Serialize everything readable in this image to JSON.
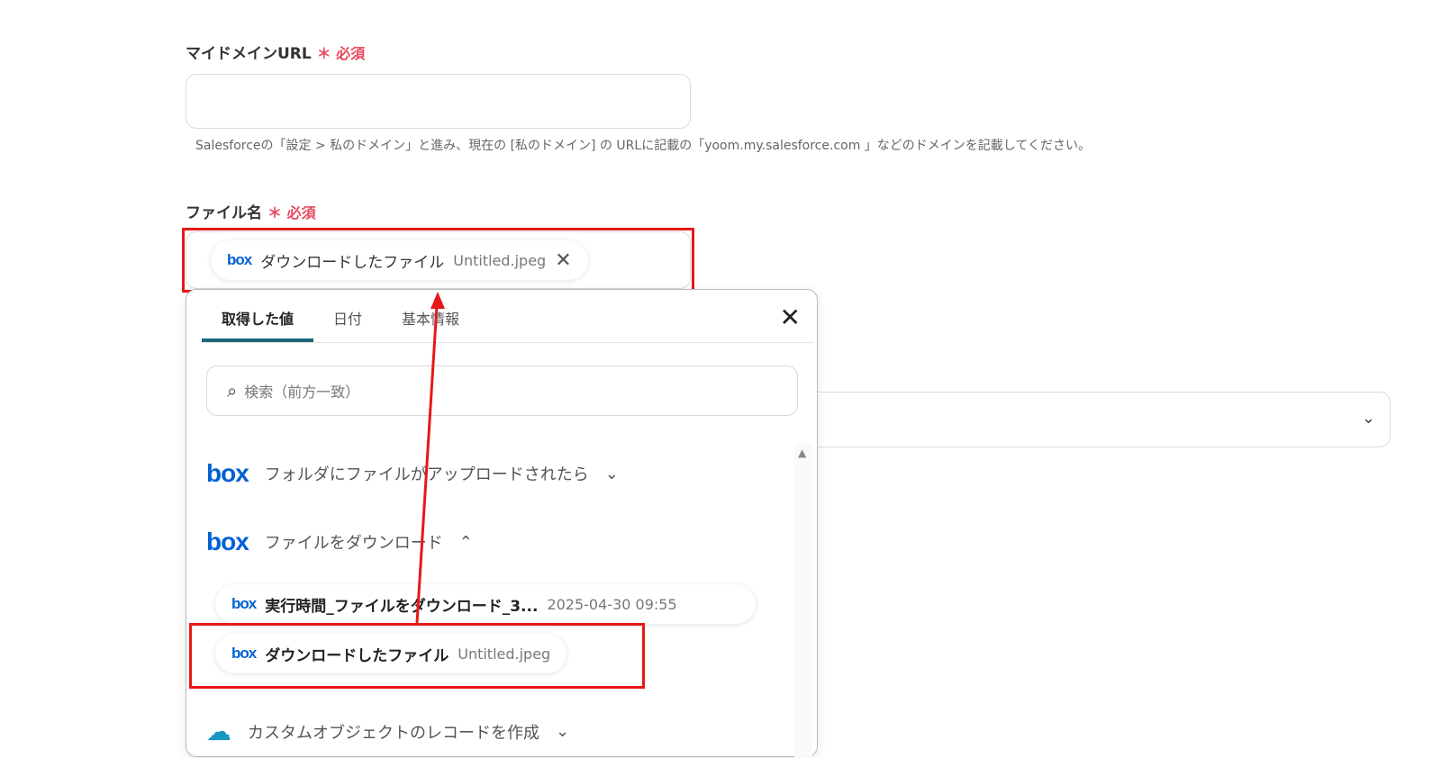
{
  "domain_field": {
    "label": "マイドメインURL",
    "required": "＊ 必須",
    "value": "",
    "hint": "Salesforceの「設定 > 私のドメイン」と進み、現在の [私のドメイン] の URLに記載の「yoom.my.salesforce.com 」などのドメインを記載してください。"
  },
  "file_field": {
    "label": "ファイル名",
    "required": "＊ 必須",
    "chip_icon": "box",
    "chip_label": "ダウンロードしたファイル",
    "chip_value": "Untitled.jpeg"
  },
  "popup": {
    "tabs": [
      "取得した値",
      "日付",
      "基本情報"
    ],
    "search_placeholder": "検索（前方一致）",
    "sections": [
      {
        "icon": "box",
        "label": "フォルダにファイルがアップロードされたら",
        "state": "collapsed"
      },
      {
        "icon": "box",
        "label": "ファイルをダウンロード",
        "state": "expanded"
      },
      {
        "icon": "salesforce",
        "label": "カスタムオブジェクトのレコードを作成",
        "state": "collapsed"
      }
    ],
    "items": [
      {
        "icon": "box",
        "label": "実行時間_ファイルをダウンロード_3...",
        "value": "2025-04-30 09:55"
      },
      {
        "icon": "box",
        "label": "ダウンロードしたファイル",
        "value": "Untitled.jpeg"
      }
    ]
  },
  "colors": {
    "annotation": "#e81818",
    "required": "#e8495e",
    "box": "#0061d5"
  }
}
